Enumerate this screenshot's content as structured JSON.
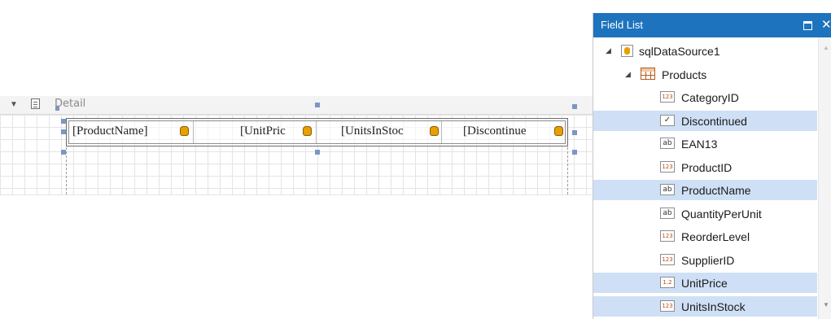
{
  "colors": {
    "panel_title_bg": "#1e73be",
    "selection": "#cfe0f6",
    "handle": "#7a97c4",
    "field_icon_db": "#e8a000"
  },
  "band": {
    "label": "Detail",
    "collapse_icon": "collapse-triangle-icon",
    "icon": "detail-band-icon"
  },
  "table": {
    "cells": [
      {
        "text": "[ProductName]",
        "icon": "field-binding-icon"
      },
      {
        "text": "[UnitPric",
        "icon": "field-binding-icon"
      },
      {
        "text": "[UnitsInStoc",
        "icon": "field-binding-icon"
      },
      {
        "text": "[Discontinue",
        "icon": "field-binding-icon"
      }
    ]
  },
  "field_list": {
    "title": "Field List",
    "maximize_icon": "maximize-icon",
    "close_icon": "close-icon",
    "datasource": {
      "label": "sqlDataSource1",
      "icon": "datasource-icon",
      "expanded": true
    },
    "table": {
      "label": "Products",
      "icon": "table-icon",
      "expanded": true
    },
    "fields": [
      {
        "label": "CategoryID",
        "type": "123",
        "selected": false
      },
      {
        "label": "Discontinued",
        "type": "check",
        "selected": true
      },
      {
        "label": "EAN13",
        "type": "ab",
        "selected": false
      },
      {
        "label": "ProductID",
        "type": "123",
        "selected": false
      },
      {
        "label": "ProductName",
        "type": "ab",
        "selected": true
      },
      {
        "label": "QuantityPerUnit",
        "type": "ab",
        "selected": false
      },
      {
        "label": "ReorderLevel",
        "type": "123",
        "selected": false
      },
      {
        "label": "SupplierID",
        "type": "123",
        "selected": false
      },
      {
        "label": "UnitPrice",
        "type": "1.2",
        "selected": true
      },
      {
        "label": "UnitsInStock",
        "type": "123",
        "selected": true
      }
    ]
  }
}
